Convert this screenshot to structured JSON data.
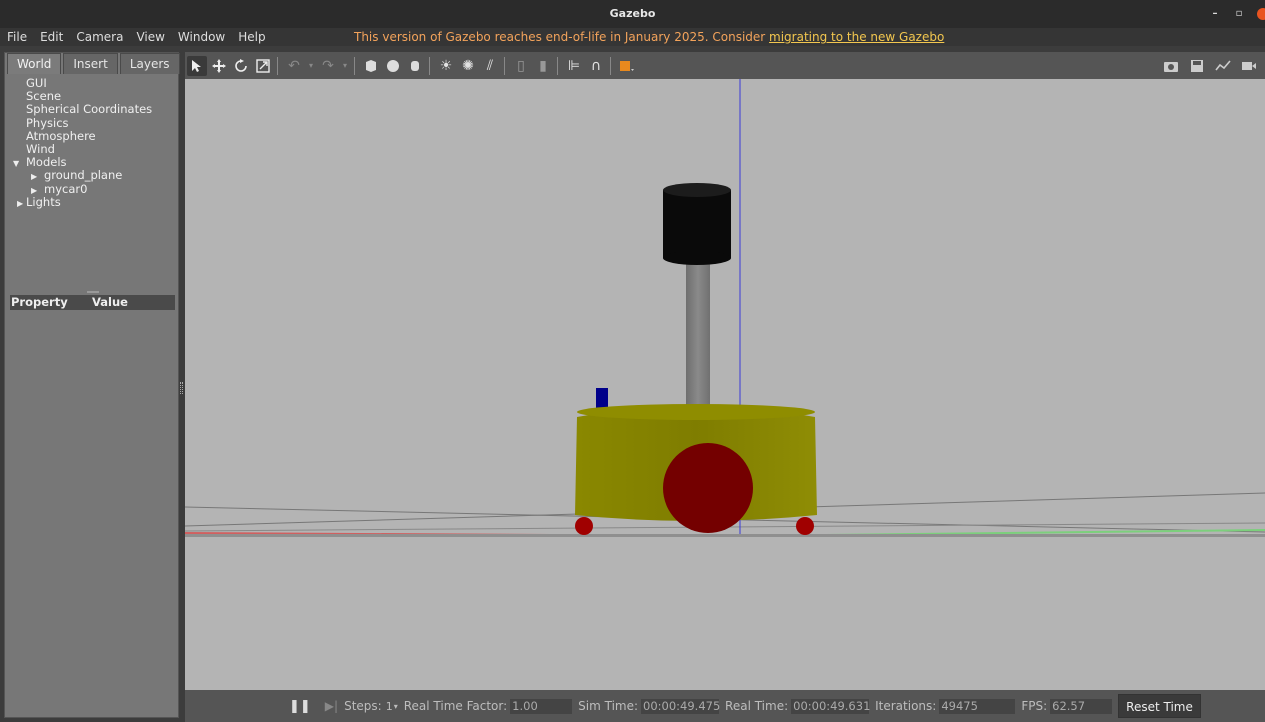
{
  "window": {
    "title": "Gazebo",
    "minimize_icon": "–",
    "restore_icon": "▫"
  },
  "menu": {
    "items": [
      "File",
      "Edit",
      "Camera",
      "View",
      "Window",
      "Help"
    ]
  },
  "notice": {
    "text": "This version of Gazebo reaches end-of-life in January 2025. Consider ",
    "link": "migrating to the new Gazebo"
  },
  "tabs": [
    "World",
    "Insert",
    "Layers"
  ],
  "tree": {
    "gui": "GUI",
    "scene": "Scene",
    "spherical": "Spherical Coordinates",
    "physics": "Physics",
    "atmosphere": "Atmosphere",
    "wind": "Wind",
    "models": "Models",
    "ground_plane": "ground_plane",
    "mycar0": "mycar0",
    "lights": "Lights"
  },
  "properties": {
    "col_property": "Property",
    "col_value": "Value"
  },
  "status": {
    "steps_label": "Steps:",
    "steps_value": "1",
    "rtf_label": "Real Time Factor:",
    "rtf_value": "1.00",
    "sim_time_label": "Sim Time:",
    "sim_time_value": "00:00:49.475",
    "real_time_label": "Real Time:",
    "real_time_value": "00:00:49.631",
    "iterations_label": "Iterations:",
    "iterations_value": "49475",
    "fps_label": "FPS:",
    "fps_value": "62.57",
    "reset_label": "Reset Time"
  },
  "colors": {
    "body": "#8a8a00",
    "wheels": "#7a0000",
    "lidar": "#0a0a0a",
    "camera": "#00008a",
    "notice": "#f3a35b"
  }
}
